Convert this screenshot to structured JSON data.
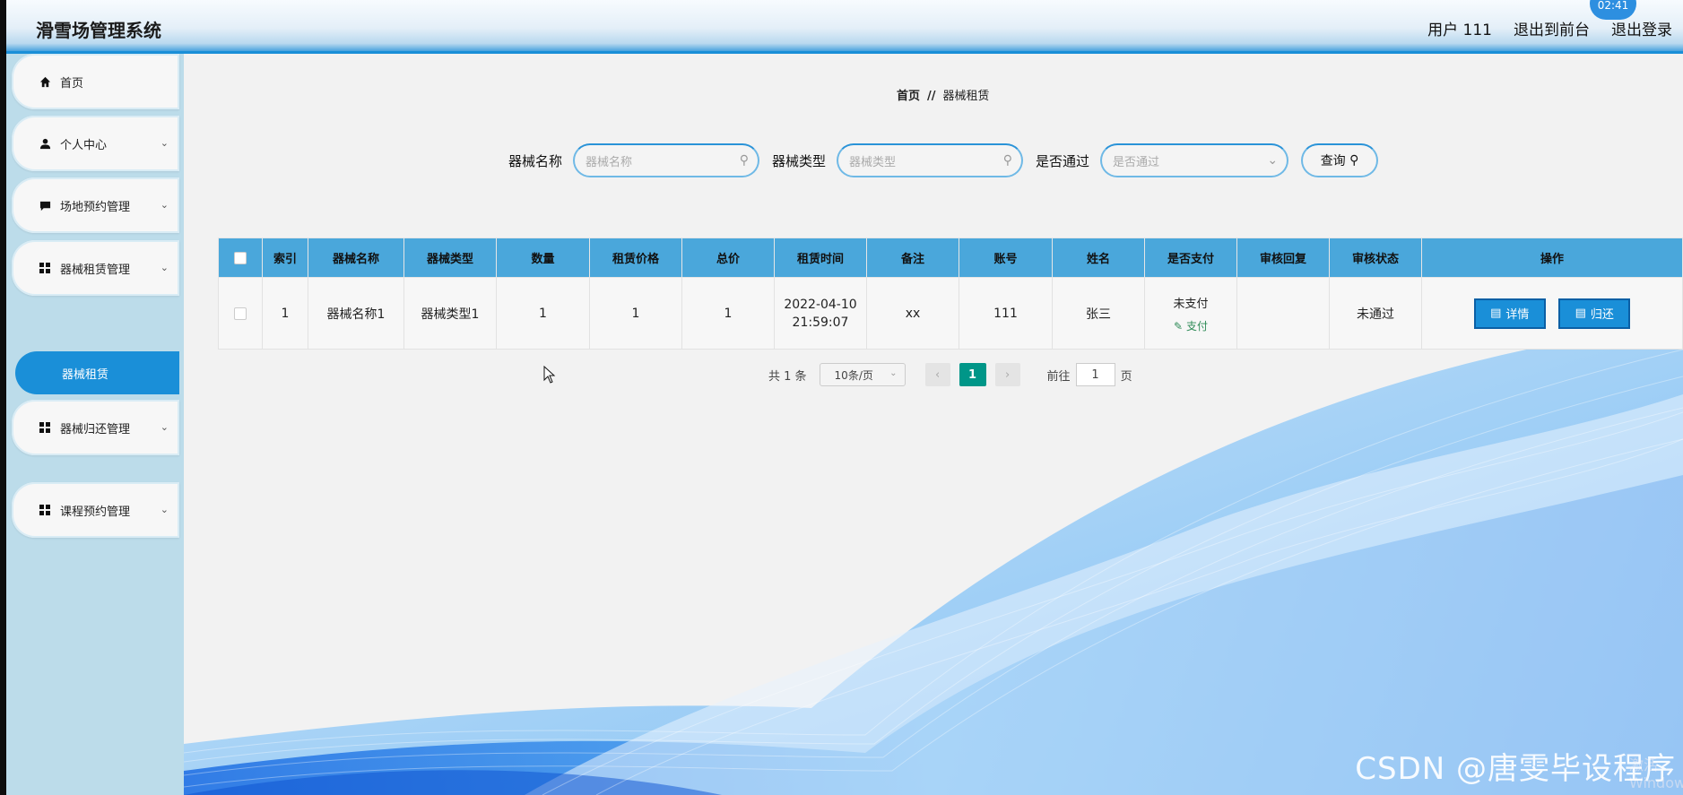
{
  "header": {
    "title": "滑雪场管理系统",
    "user": "用户 111",
    "back_to_front": "退出到前台",
    "logout": "退出登录",
    "clock": "02:41"
  },
  "sidebar": {
    "items": [
      {
        "label": "首页",
        "icon": "home-icon"
      },
      {
        "label": "个人中心",
        "icon": "user-icon"
      },
      {
        "label": "场地预约管理",
        "icon": "comment-icon"
      },
      {
        "label": "器械租赁管理",
        "icon": "grid-icon"
      },
      {
        "label": "器械归还管理",
        "icon": "grid-icon"
      },
      {
        "label": "课程预约管理",
        "icon": "grid-icon"
      }
    ],
    "active_sub": "器械租赁"
  },
  "breadcrumb": {
    "home": "首页",
    "sep": "//",
    "current": "器械租赁"
  },
  "search": {
    "name_label": "器械名称",
    "name_placeholder": "器械名称",
    "type_label": "器械类型",
    "type_placeholder": "器械类型",
    "pass_label": "是否通过",
    "pass_placeholder": "是否通过",
    "query_label": "查询"
  },
  "table": {
    "headers": [
      "索引",
      "器械名称",
      "器械类型",
      "数量",
      "租赁价格",
      "总价",
      "租赁时间",
      "备注",
      "账号",
      "姓名",
      "是否支付",
      "审核回复",
      "审核状态",
      "操作"
    ],
    "rows": [
      {
        "index": "1",
        "name": "器械名称1",
        "type": "器械类型1",
        "quantity": "1",
        "price": "1",
        "total": "1",
        "time_date": "2022-04-10",
        "time_clock": "21:59:07",
        "note": "xx",
        "account": "111",
        "person": "张三",
        "paid": "未支付",
        "pay_link": "支付",
        "reply": "",
        "status": "未通过",
        "detail_btn": "详情",
        "return_btn": "归还"
      }
    ]
  },
  "pagination": {
    "total": "共 1 条",
    "page_size": "10条/页",
    "current_page": "1",
    "goto_label": "前往",
    "goto_value": "1",
    "page_unit": "页"
  },
  "watermark": "CSDN @唐雯毕设程序",
  "watermark_faint": "激活 Windows",
  "colors": {
    "accent": "#1a8fd8",
    "table_header": "#4aa7db",
    "sidebar_bg": "#bcdcea",
    "page_active": "#009688"
  }
}
